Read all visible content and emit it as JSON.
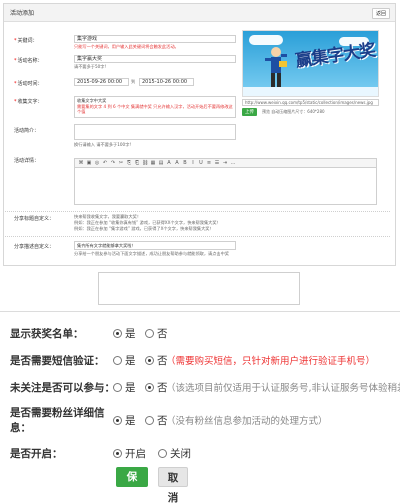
{
  "panel": {
    "title": "活动添加",
    "back": "返回"
  },
  "form": {
    "keyword": {
      "label": "关键词：",
      "value": "集字游戏",
      "note": "只能写一个关键词，用户输入此关键词将会触发此活动。"
    },
    "name": {
      "label": "活动名称：",
      "value": "集字赢大奖",
      "note": "请不要多于50字!"
    },
    "time": {
      "label": "活动时间：",
      "start": "2015-09-26 00:00",
      "sep": "到",
      "end": "2015-10-26 00:00"
    },
    "collect": {
      "label": "收集文字：",
      "value": "收集文字中大奖",
      "note": "需要集的文字 4 到 6 个中文 集满就中奖 只允许输入汉字，活动开始后不要再修改这个值"
    },
    "intro": {
      "label": "活动简介：",
      "note": "换行请输入 请不要多于100字!"
    },
    "detail": {
      "label": "活动详情："
    },
    "share_title": {
      "label": "分享标题自定义：",
      "line1": "快来帮我收集文字，我要赢取大奖！",
      "line2": "例如：我正在参加 “收集你真有钱” 游戏，已获得XX个文字，快来帮我集大奖！",
      "line3": "例如：我正在参加 “集字游戏” 游戏，已获得了X个文字，快来帮我集大奖！"
    },
    "share_desc": {
      "label": "分享描述自定义：",
      "line1": "集齐所有文字就能够拿大奖啦！",
      "line2": "分享给一个朋友参与活动下面文字描述，成功让朋友帮助参与就能领取，请点击中奖"
    }
  },
  "promo": {
    "title": "赢集字大奖",
    "url": "http://www.weixin.qq.com/tp5/static/collection/images/news.jpg",
    "upload": "上传",
    "upload_note": "预览  自动压缩图片尺寸：640*280"
  },
  "toolbar": {
    "icons": [
      "source-icon",
      "save-icon",
      "preview-icon",
      "undo-icon",
      "redo-icon",
      "cut-icon",
      "copy-icon",
      "paste-icon",
      "link-icon",
      "picture-icon",
      "table-icon",
      "font-icon",
      "size-icon",
      "bold-icon",
      "italic-icon",
      "underline-icon",
      "align-icon",
      "list-icon",
      "indent-icon",
      "more-icon"
    ],
    "glyphs": [
      "⌘",
      "▣",
      "◎",
      "↶",
      "↷",
      "✂",
      "⎘",
      "⎗",
      "⛓",
      "▦",
      "▤",
      "A",
      "A",
      "B",
      "I",
      "U",
      "≡",
      "☰",
      "⇥",
      "…"
    ]
  },
  "settings": {
    "show_winners": {
      "label": "显示获奖名单：",
      "options": [
        "是",
        "否"
      ],
      "selected": 0
    },
    "sms_verify": {
      "label": "是否需要短信验证：",
      "options": [
        "是",
        "否"
      ],
      "selected": 1,
      "hint": "（需要购买短信，只针对新用户进行验证手机号）"
    },
    "unfollowed": {
      "label": "未关注是否可以参与：",
      "options": [
        "是",
        "否"
      ],
      "selected": 1,
      "hint": "（该选项目前仅适用于认证服务号,非认证服务号体验稍差）"
    },
    "fan_info": {
      "label": "是否需要粉丝详细信息：",
      "options": [
        "是",
        "否"
      ],
      "selected": 0,
      "hint": "（没有粉丝信息参加活动的处理方式）"
    },
    "enabled": {
      "label": "是否开启：",
      "options": [
        "开启",
        "关闭"
      ],
      "selected": 0
    },
    "save": "保存",
    "cancel": "取消"
  },
  "colors": {
    "accent_green": "#3aa845",
    "warn_red": "#e33333"
  }
}
